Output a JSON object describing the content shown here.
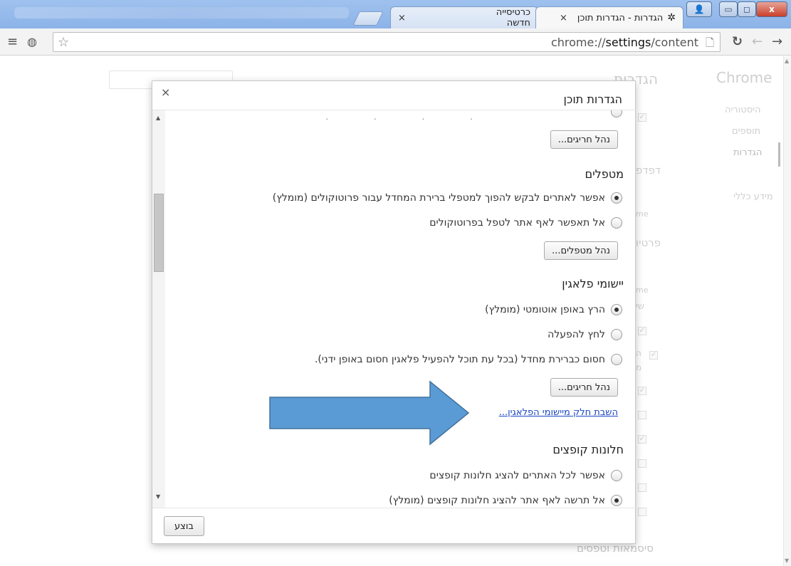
{
  "browser": {
    "tabs": [
      {
        "label": "הגדרות - הגדרות תוכן",
        "close": "×"
      },
      {
        "label": "כרטיסייה חדשה",
        "close": "×"
      }
    ],
    "window_buttons": {
      "minimize": "▭",
      "maximize": "◻",
      "close": "x",
      "user": "👤"
    },
    "url_scheme": "chrome://",
    "url_host": "settings",
    "url_path": "/content"
  },
  "background_page": {
    "brand": "Chrome",
    "heading": "הגדרות",
    "sidebar": [
      "היסטוריה",
      "תוספים",
      "הגדרות",
      "מידע כללי"
    ],
    "fragments": [
      "דפדפ",
      "פרטיו",
      "me",
      "me",
      "שי",
      "ה",
      "מ",
      "סיסמאות וטפסים"
    ]
  },
  "dialog": {
    "title": "הגדרות תוכן",
    "close": "×",
    "top_manage_button": "נהל חריגים...",
    "sections": [
      {
        "title": "מטפלים",
        "options": [
          {
            "label": "אפשר לאתרים לבקש להפוך למטפלי ברירת המחדל עבור פרוטוקולים (מומלץ)",
            "selected": true
          },
          {
            "label": "אל תאפשר לאף אתר לטפל בפרוטוקולים",
            "selected": false
          }
        ],
        "button": "נהל מטפלים..."
      },
      {
        "title": "יישומי פלאגין",
        "options": [
          {
            "label": "הרץ באופן אוטומטי (מומלץ)",
            "selected": true
          },
          {
            "label": "לחץ להפעלה",
            "selected": false
          },
          {
            "label": "חסום כברירת מחדל (בכל עת תוכל להפעיל פלאגין חסום באופן ידני).",
            "selected": false
          }
        ],
        "button": "נהל חריגים...",
        "link": "השבת חלק מיישומי הפלאגין..."
      },
      {
        "title": "חלונות קופצים",
        "options": [
          {
            "label": "אפשר לכל האתרים להציג חלונות קופצים",
            "selected": false
          },
          {
            "label": "אל תרשה לאף אתר להציג חלונות קופצים (מומלץ)",
            "selected": true
          }
        ]
      }
    ],
    "done_button": "בוצע"
  },
  "annotation": {
    "arrow_color": "#5b9bd5"
  }
}
